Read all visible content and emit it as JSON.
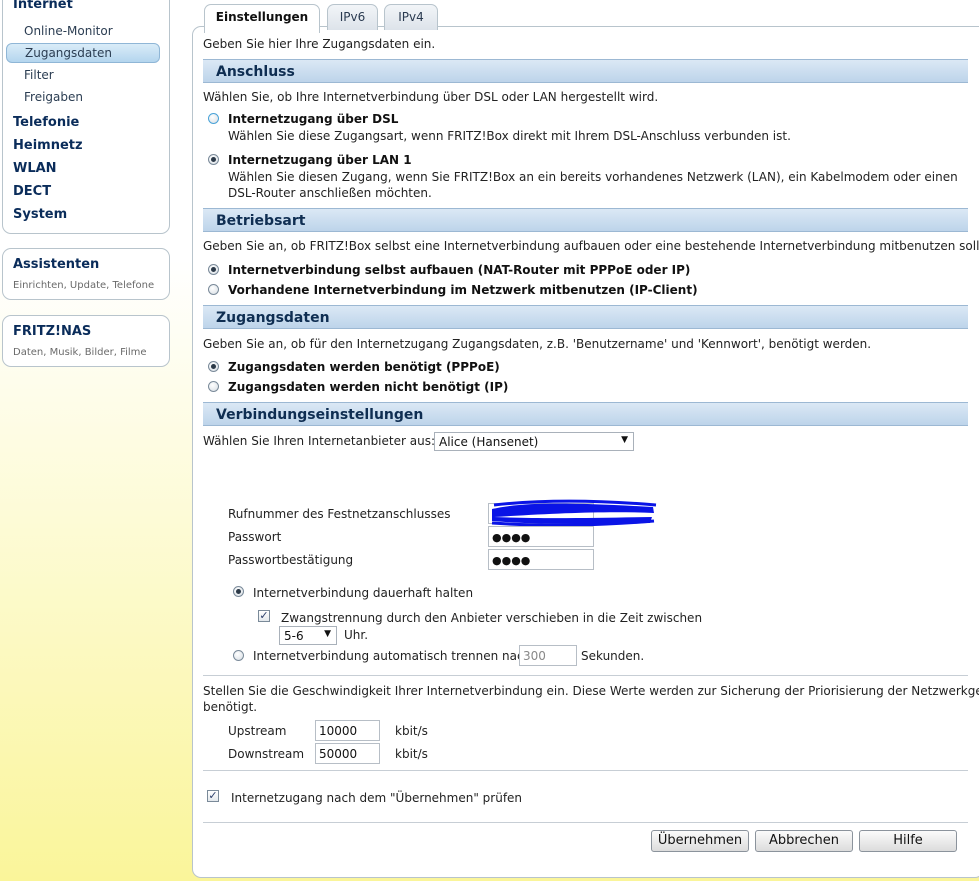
{
  "nav": {
    "internet": "Internet",
    "sub": [
      "Online-Monitor",
      "Zugangsdaten",
      "Filter",
      "Freigaben"
    ],
    "sections": [
      "Telefonie",
      "Heimnetz",
      "WLAN",
      "DECT",
      "System"
    ],
    "assist_title": "Assistenten",
    "assist_desc": "Einrichten, Update, Telefone",
    "nas_title": "FRITZ!NAS",
    "nas_desc": "Daten, Musik, Bilder, Filme"
  },
  "tabs": [
    "Einstellungen",
    "IPv6",
    "IPv4"
  ],
  "intro": "Geben Sie hier Ihre Zugangsdaten ein.",
  "anschluss": {
    "title": "Anschluss",
    "desc": "Wählen Sie, ob Ihre Internetverbindung über DSL oder LAN hergestellt wird.",
    "dsl_label": "Internetzugang über DSL",
    "dsl_desc": "Wählen Sie diese Zugangsart, wenn FRITZ!Box direkt mit Ihrem DSL-Anschluss verbunden ist.",
    "lan_label": "Internetzugang über LAN 1",
    "lan_desc1": "Wählen Sie diesen Zugang, wenn Sie FRITZ!Box an ein bereits vorhandenes Netzwerk (LAN), ein Kabelmodem oder einen",
    "lan_desc2": "DSL-Router anschließen möchten."
  },
  "betriebsart": {
    "title": "Betriebsart",
    "desc": "Geben Sie an, ob FRITZ!Box selbst eine Internetverbindung aufbauen oder eine bestehende Internetverbindung mitbenutzen soll.",
    "opt1": "Internetverbindung selbst aufbauen (NAT-Router mit PPPoE oder IP)",
    "opt2": "Vorhandene Internetverbindung im Netzwerk mitbenutzen (IP-Client)"
  },
  "zugangsdaten": {
    "title": "Zugangsdaten",
    "desc": "Geben Sie an, ob für den Internetzugang Zugangsdaten, z.B. 'Benutzername' und 'Kennwort', benötigt werden.",
    "opt1": "Zugangsdaten werden benötigt (PPPoE)",
    "opt2": "Zugangsdaten werden nicht benötigt (IP)"
  },
  "verbindung": {
    "title": "Verbindungseinstellungen",
    "provider_label": "Wählen Sie Ihren Internetanbieter aus:",
    "provider_value": "Alice (Hansenet)",
    "rufnummer_label": "Rufnummer des Festnetzanschlusses",
    "passwort_label": "Passwort",
    "passwort_value": "●●●●",
    "bestaetigung_label": "Passwortbestätigung",
    "bestaetigung_value": "●●●●",
    "dauerhaft_label": "Internetverbindung dauerhaft halten",
    "zwangs_label": "Zwangstrennung durch den Anbieter verschieben in die Zeit zwischen",
    "zeit_value": "5-6",
    "uhr_label": "Uhr.",
    "auto_label": "Internetverbindung automatisch trennen nach",
    "auto_value": "300",
    "sekunden_label": "Sekunden."
  },
  "speed": {
    "desc1": "Stellen Sie die Geschwindigkeit Ihrer Internetverbindung ein. Diese Werte werden zur Sicherung der Priorisierung der Netzwerkgeräte",
    "desc2": "benötigt.",
    "upstream_label": "Upstream",
    "upstream_value": "10000",
    "downstream_label": "Downstream",
    "downstream_value": "50000",
    "unit": "kbit/s"
  },
  "pruefen_label": "Internetzugang nach dem \"Übernehmen\" prüfen",
  "buttons": {
    "apply": "Übernehmen",
    "cancel": "Abbrechen",
    "help": "Hilfe"
  },
  "colors": {
    "redaction": "#0a14e6",
    "header": "#bdd4ea",
    "active_nav": "#b4d5ee"
  }
}
